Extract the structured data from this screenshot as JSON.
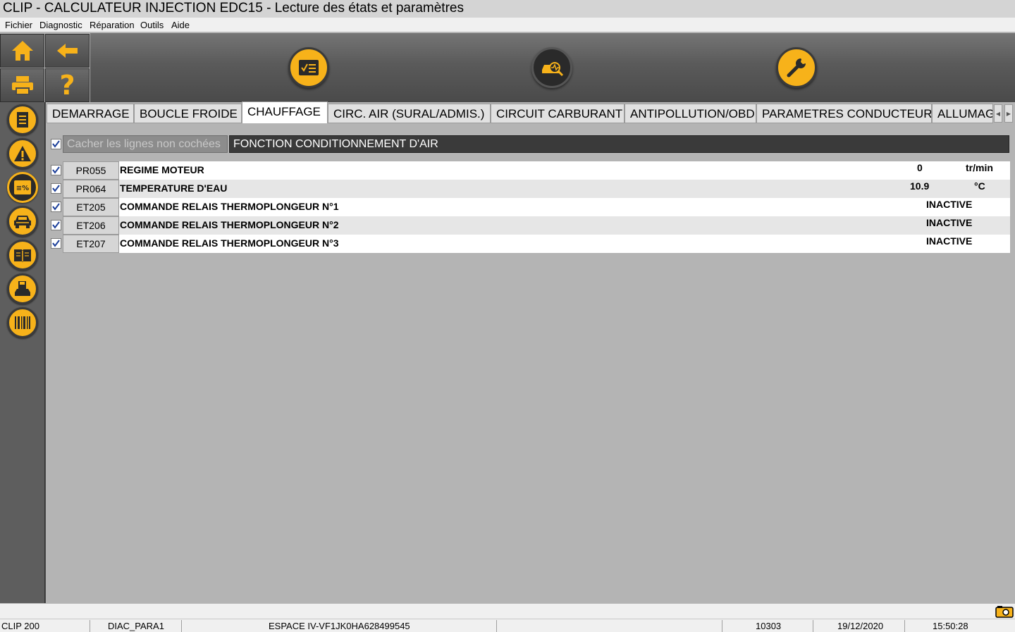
{
  "window": {
    "title": "CLIP - CALCULATEUR INJECTION EDC15 - Lecture des états et paramètres"
  },
  "menu": [
    "Fichier",
    "Diagnostic",
    "Réparation",
    "Outils",
    "Aide"
  ],
  "nav_icons": [
    "home-icon",
    "back-arrow-icon",
    "printer-icon",
    "help-icon"
  ],
  "toolbar_icons": [
    "checklist-icon",
    "car-diagnostic-icon",
    "wrench-icon"
  ],
  "sidebar_icons": [
    "document-icon",
    "warning-icon",
    "parameters-icon",
    "vehicle-icon",
    "manual-book-icon",
    "car-save-icon",
    "barcode-icon"
  ],
  "tabs": [
    {
      "label": "DEMARRAGE",
      "active": false
    },
    {
      "label": "BOUCLE FROIDE",
      "active": false
    },
    {
      "label": "CHAUFFAGE",
      "active": true
    },
    {
      "label": "CIRC. AIR (SURAL/ADMIS.)",
      "active": false
    },
    {
      "label": "CIRCUIT CARBURANT",
      "active": false
    },
    {
      "label": "ANTIPOLLUTION/OBD",
      "active": false
    },
    {
      "label": "PARAMETRES CONDUCTEUR",
      "active": false
    },
    {
      "label": "ALLUMAG",
      "active": false
    }
  ],
  "filter": {
    "label": "Cacher les lignes non cochées",
    "checked": true
  },
  "group_header": "FONCTION CONDITIONNEMENT D'AIR",
  "rows": [
    {
      "code": "PR055",
      "label": "REGIME MOTEUR",
      "value": "0",
      "unit": "tr/min",
      "checked": true
    },
    {
      "code": "PR064",
      "label": "TEMPERATURE D'EAU",
      "value": "10.9",
      "unit": "°C",
      "checked": true
    },
    {
      "code": "ET205",
      "label": "COMMANDE RELAIS THERMOPLONGEUR N°1",
      "value": "INACTIVE",
      "unit": "",
      "checked": true
    },
    {
      "code": "ET206",
      "label": "COMMANDE RELAIS THERMOPLONGEUR N°2",
      "value": "INACTIVE",
      "unit": "",
      "checked": true
    },
    {
      "code": "ET207",
      "label": "COMMANDE RELAIS THERMOPLONGEUR N°3",
      "value": "INACTIVE",
      "unit": "",
      "checked": true
    }
  ],
  "status": {
    "device": "CLIP 200",
    "module": "DIAC_PARA1",
    "vehicle": "ESPACE IV-VF1JK0HA628499545",
    "code": "10303",
    "date": "19/12/2020",
    "time": "15:50:28"
  },
  "colors": {
    "accent": "#f7b21a",
    "chrome": "#5e5e5e",
    "content_bg": "#b4b4b4"
  }
}
